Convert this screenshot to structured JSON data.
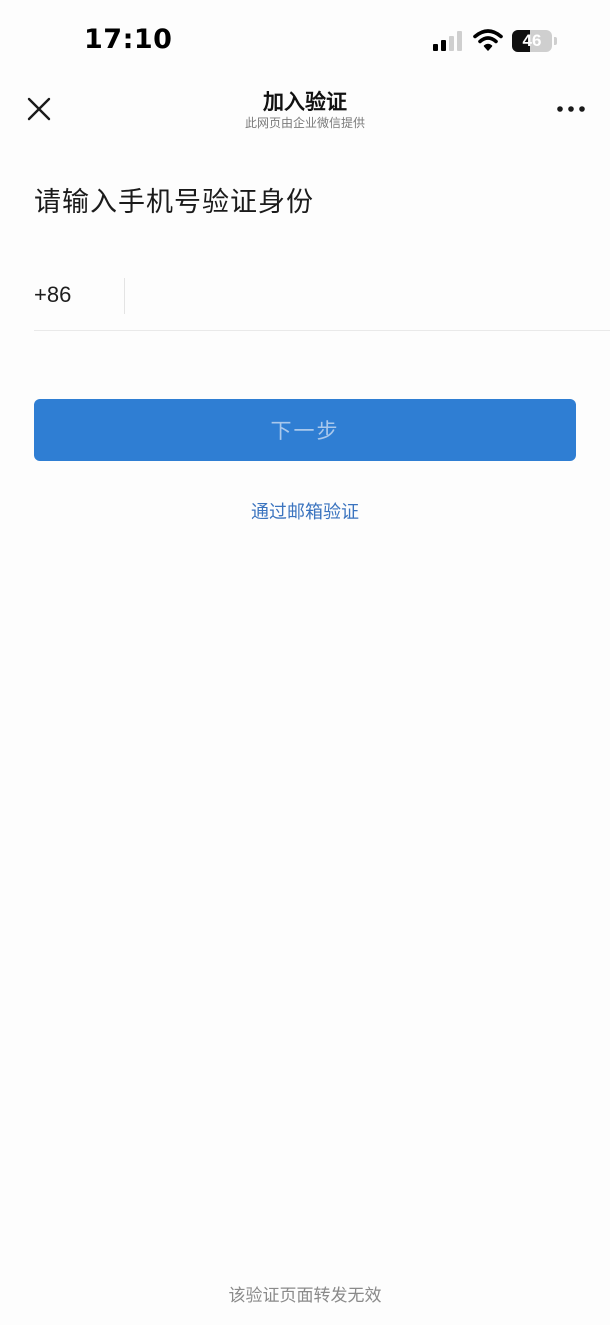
{
  "status_bar": {
    "time": "17:10",
    "battery_level": "46",
    "battery_fraction": 0.46,
    "signal_bars_active": 2,
    "signal_bars_total": 4
  },
  "nav": {
    "title": "加入验证",
    "subtitle": "此网页由企业微信提供",
    "close_icon": "close-icon",
    "more_icon": "more-icon"
  },
  "form": {
    "heading": "请输入手机号验证身份",
    "country_code": "+86",
    "phone_value": "",
    "phone_placeholder": "",
    "next_label": "下一步",
    "email_link": "通过邮箱验证"
  },
  "footer": {
    "note": "该验证页面转发无效"
  },
  "colors": {
    "accent": "#2f7ed3",
    "link": "#3b74bf",
    "button_text": "#a9c8ec",
    "background": "#fdfdfd"
  }
}
